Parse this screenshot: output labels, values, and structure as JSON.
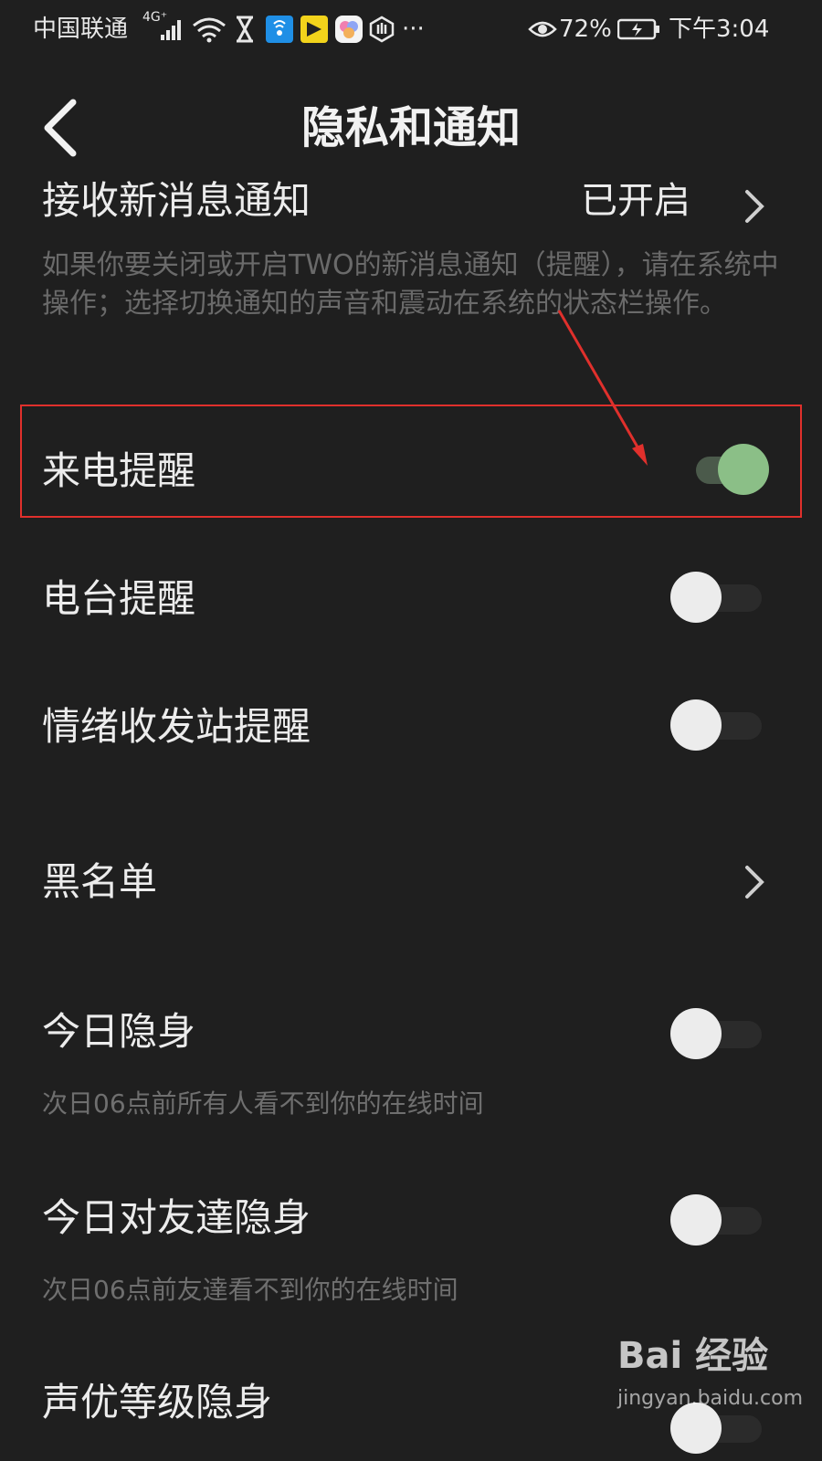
{
  "status_bar": {
    "carrier": "中国联通",
    "network": "4G⁺",
    "battery_percent": "72%",
    "time": "下午3:04",
    "more": "···"
  },
  "header": {
    "title": "隐私和通知"
  },
  "notify_section": {
    "label": "接收新消息通知",
    "value": "已开启",
    "description": "如果你要关闭或开启TWO的新消息通知（提醒），请在系统中操作；选择切换通知的声音和震动在系统的状态栏操作。"
  },
  "rows": [
    {
      "label": "来电提醒",
      "on": true
    },
    {
      "label": "电台提醒",
      "on": false
    },
    {
      "label": "情绪收发站提醒",
      "on": false
    },
    {
      "label": "黑名单"
    },
    {
      "label": "今日隐身",
      "on": false,
      "description": "次日06点前所有人看不到你的在线时间"
    },
    {
      "label": "今日对友達隐身",
      "on": false,
      "description": "次日06点前友達看不到你的在线时间"
    },
    {
      "label": "声优等级隐身",
      "on": false
    }
  ],
  "watermark": {
    "logo": "Bai 经验",
    "sub": "jingyan.baidu.com"
  },
  "colors": {
    "background": "#1f1f1f",
    "toggle_on": "#8bbf87",
    "highlight": "#e0302c"
  }
}
